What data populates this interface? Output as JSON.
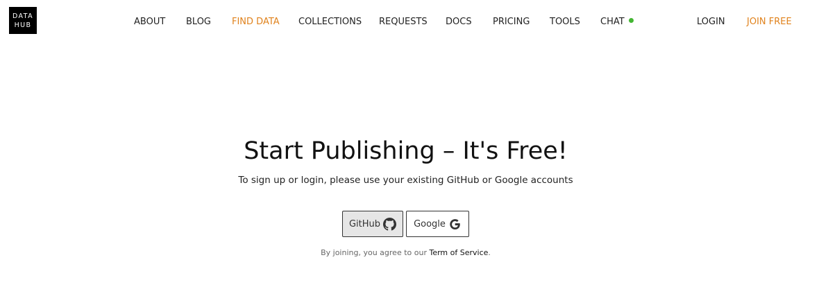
{
  "logo": {
    "line1": "DATA",
    "line2": "HUB"
  },
  "nav": {
    "about": "ABOUT",
    "blog": "BLOG",
    "find_data": "FIND DATA",
    "collections": "COLLECTIONS",
    "requests": "REQUESTS",
    "docs": "DOCS",
    "pricing": "PRICING",
    "tools": "TOOLS",
    "chat": "CHAT",
    "login": "LOGIN",
    "join_free": "JOIN FREE"
  },
  "colors": {
    "accent": "#e0821c",
    "online_dot": "#44b633",
    "text": "#222222"
  },
  "hero": {
    "title": "Start Publishing – It's Free!",
    "subtitle": "To sign up or login, please use your existing GitHub or Google accounts"
  },
  "auth": {
    "github_label": "GitHub",
    "github_icon": "github-icon",
    "google_label": "Google",
    "google_icon": "google-icon"
  },
  "terms": {
    "prefix": "By joining, you agree to our",
    "link": "Term of Service",
    "suffix": "."
  }
}
